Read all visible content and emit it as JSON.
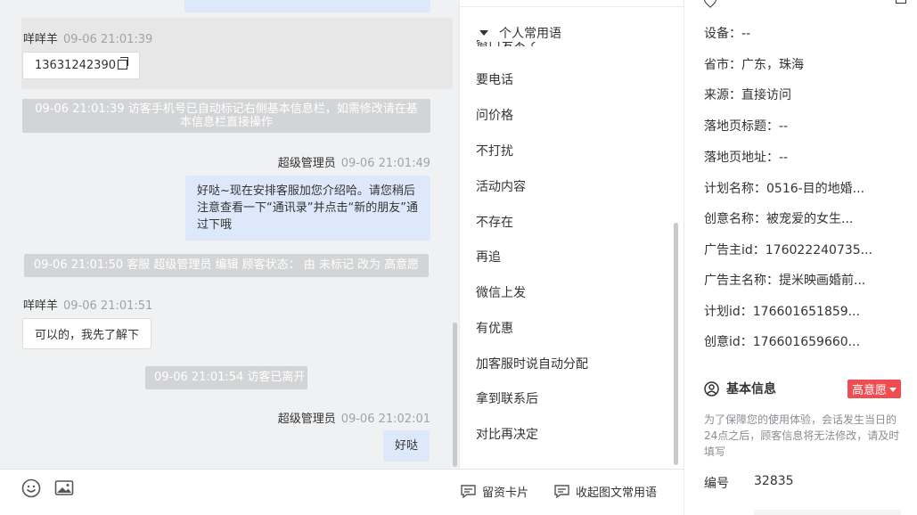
{
  "chat": {
    "messages": [
      {
        "sender": "咩咩羊",
        "time": "09-06 21:01:39",
        "text": "13631242390"
      },
      {
        "notice": "09-06 21:01:39 访客手机号已自动标记右侧基本信息栏，如需修改请在基本信息栏直接操作"
      },
      {
        "sender": "超级管理员",
        "time": "09-06 21:01:49",
        "text": "好哒~现在安排客服加您介绍哈。请您稍后注意查看一下“通讯录”并点击“新的朋友”通过下哦"
      },
      {
        "notice": "09-06 21:01:50 客服 超级管理员 编辑 顾客状态： 由 未标记 改为 高意愿"
      },
      {
        "sender": "咩咩羊",
        "time": "09-06 21:01:51",
        "text": "可以的，我先了解下"
      },
      {
        "notice": "09-06 21:01:54 访客已离开"
      },
      {
        "sender": "超级管理员",
        "time": "09-06 21:02:01",
        "text": "好哒"
      }
    ]
  },
  "toolbar": {
    "emoji_icon": "smiley-icon",
    "image_icon": "image-icon",
    "card_label": "留资卡片",
    "collapse_label": "收起图文常用语"
  },
  "phrases": {
    "header": "个人常用语",
    "clipped_item": "窗口发不了",
    "items": [
      "要电话",
      "问价格",
      "不打扰",
      "活动内容",
      "不存在",
      "再追",
      "微信上发",
      "有优惠",
      "加客服时说自动分配",
      "拿到联系后",
      "对比再决定"
    ]
  },
  "info": {
    "source_rows": [
      "设备：--",
      "省市：广东，珠海",
      "来源：直接访问",
      "落地页标题：--",
      "落地页地址：--",
      "计划名称：0516-目的地婚...",
      "创意名称：被宠爱的女生...",
      "广告主id：176022240735...",
      "广告主名称：提米映画婚前...",
      "计划id：176601651859...",
      "创意id：176601659660..."
    ],
    "basic_title": "基本信息",
    "status_badge": "高意愿",
    "warning": "为了保障您的使用体验，会话发生当日的24点之后，顾客信息将无法修改，请及时填写",
    "id_label": "编号",
    "id_value": "32835"
  }
}
